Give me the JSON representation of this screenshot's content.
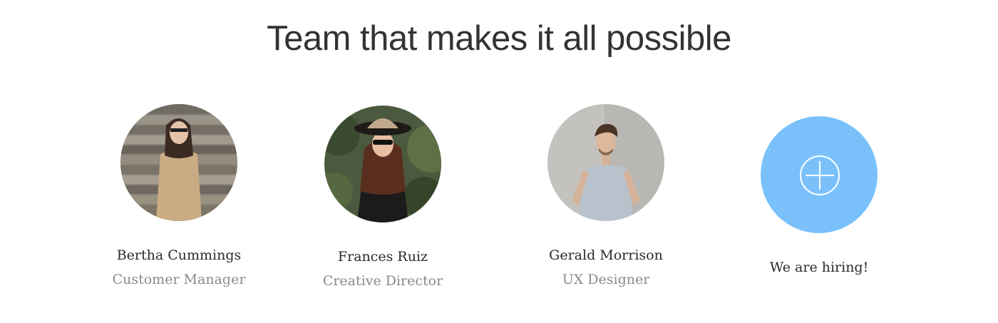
{
  "title": "Team that makes it all possible",
  "members": [
    {
      "name": "Bertha Cummings",
      "role": "Customer Manager"
    },
    {
      "name": "Frances Ruiz",
      "role": "Creative Director"
    },
    {
      "name": "Gerald Morrison",
      "role": "UX Designer"
    }
  ],
  "hiring": {
    "label": "We are hiring!",
    "icon": "plus-circle-icon",
    "color": "#7ac1fb"
  }
}
